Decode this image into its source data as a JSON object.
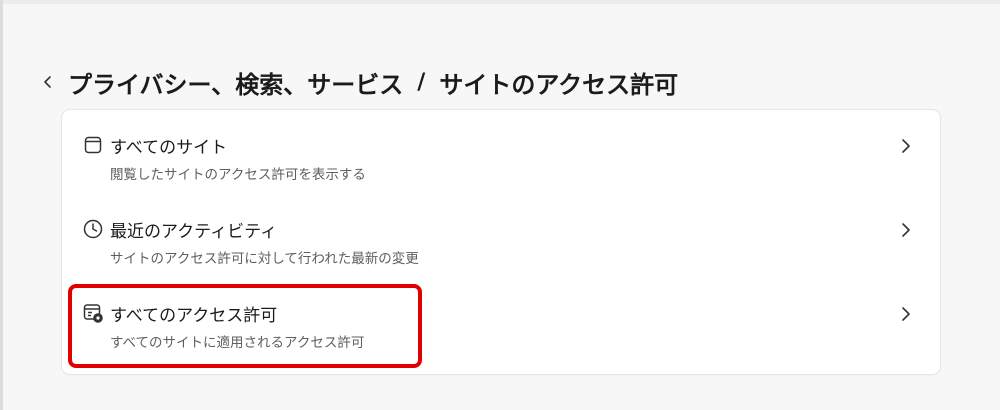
{
  "header": {
    "back_icon": "chevron-left-icon",
    "breadcrumb_parent": "プライバシー、検索、サービス",
    "breadcrumb_separator": "/",
    "breadcrumb_current": "サイトのアクセス許可"
  },
  "items": [
    {
      "icon": "browser-window-icon",
      "title": "すべてのサイト",
      "description": "閲覧したサイトのアクセス許可を表示する"
    },
    {
      "icon": "clock-icon",
      "title": "最近のアクティビティ",
      "description": "サイトのアクセス許可に対して行われた最新の変更"
    },
    {
      "icon": "site-settings-icon",
      "title": "すべてのアクセス許可",
      "description": "すべてのサイトに適用されるアクセス許可"
    }
  ],
  "colors": {
    "highlight": "#e00000",
    "background": "#f7f7f7",
    "card": "#ffffff"
  }
}
